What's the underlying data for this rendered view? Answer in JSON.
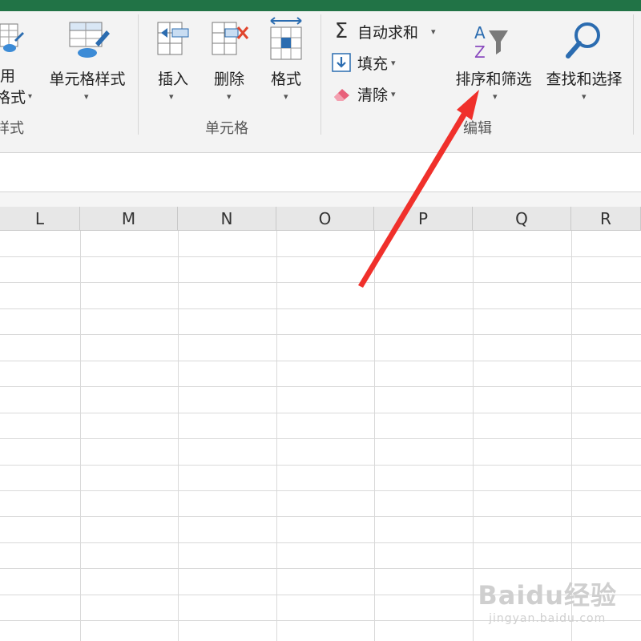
{
  "ribbon": {
    "styles_group": {
      "partial_top_label": "用",
      "partial_bottom_label": "格式",
      "cell_styles_label": "单元格样式",
      "group_label": "样式"
    },
    "cells_group": {
      "insert_label": "插入",
      "delete_label": "删除",
      "format_label": "格式",
      "group_label": "单元格"
    },
    "editing_group": {
      "autosum_label": "自动求和",
      "fill_label": "填充",
      "clear_label": "清除",
      "sort_filter_label": "排序和筛选",
      "find_select_label": "查找和选择",
      "group_label": "编辑"
    }
  },
  "sheet": {
    "columns": [
      "L",
      "M",
      "N",
      "O",
      "P",
      "Q",
      "R"
    ]
  },
  "watermark": {
    "main": "Baidu经验",
    "sub": "jingyan.baidu.com"
  },
  "colors": {
    "title_bar": "#217346",
    "arrow": "#f0302b"
  },
  "icons": {
    "autosum": "sigma-icon",
    "fill": "fill-down-icon",
    "clear": "eraser-icon",
    "sort_filter": "sort-filter-icon",
    "find_select": "magnifier-icon"
  }
}
